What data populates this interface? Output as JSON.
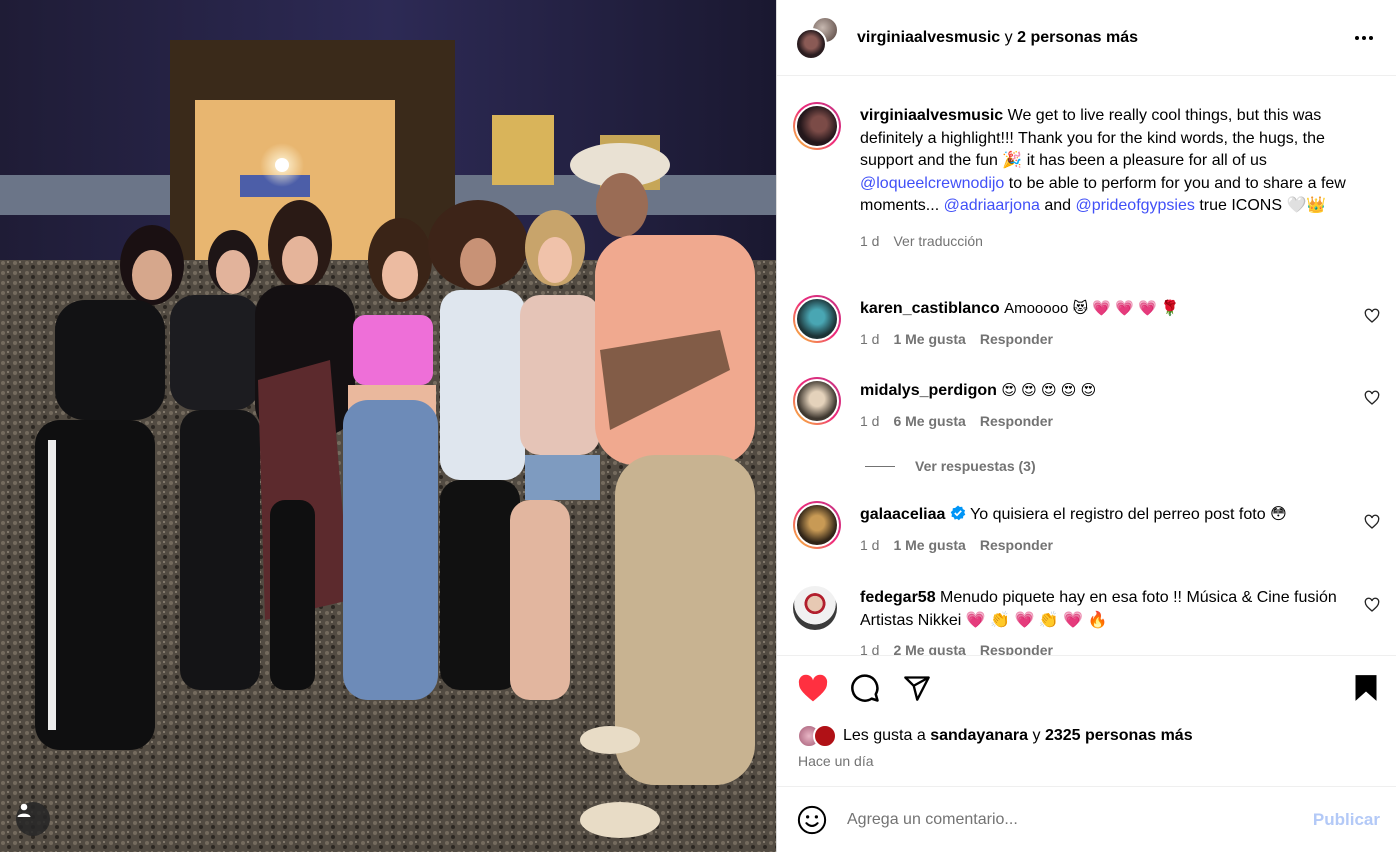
{
  "photo": {
    "description_icon": "tag-user-icon"
  },
  "header": {
    "author": "virginiaalvesmusic",
    "conjunction": "y",
    "others": "2 personas más",
    "more_icon": "more-options-icon"
  },
  "caption": {
    "username": "virginiaalvesmusic",
    "text_1": "We get to live really cool things, but this was definitely a highlight!!! Thank you for the kind words, the hugs, the support and the fun 🎉 it has been a pleasure for all of us ",
    "mention_1": "@loqueelcrewnodijo",
    "text_2": " to be able to perform for you and to share a few moments... ",
    "mention_2": "@adriaarjona",
    "text_3": " and ",
    "mention_3": "@prideofgypsies",
    "text_4": " true ICONS 🤍👑",
    "time": "1 d",
    "translate": "Ver traducción"
  },
  "comments": [
    {
      "username": "karen_castiblanco",
      "text": "Amooooo 😻 💗 💗 💗 🌹",
      "time": "1 d",
      "likes": "1 Me gusta",
      "reply": "Responder"
    },
    {
      "username": "midalys_perdigon",
      "text": "😍 😍 😍 😍 😍",
      "time": "1 d",
      "likes": "6 Me gusta",
      "reply": "Responder"
    },
    {
      "username": "galaaceliaa",
      "text": "Yo quisiera el registro del perreo post foto 😳",
      "time": "1 d",
      "likes": "1 Me gusta",
      "reply": "Responder"
    },
    {
      "username": "fedegar58",
      "text": "Menudo piquete hay en esa foto !! Música & Cine fusión Artistas Nikkei 💗 👏 💗 👏 💗 🔥",
      "time": "1 d",
      "likes": "2 Me gusta",
      "reply": "Responder"
    }
  ],
  "view_replies": "Ver respuestas (3)",
  "likes": {
    "prefix": "Les gusta a",
    "user": "sandayanara",
    "conj": "y",
    "count": "2325 personas más"
  },
  "date": "Hace un día",
  "composer": {
    "placeholder": "Agrega un comentario...",
    "publish": "Publicar"
  },
  "colors": {
    "like_red": "#ff3040",
    "mention_blue": "#4150f7",
    "publish_disabled": "#b3c9f7",
    "verified_blue": "#0095f6"
  }
}
